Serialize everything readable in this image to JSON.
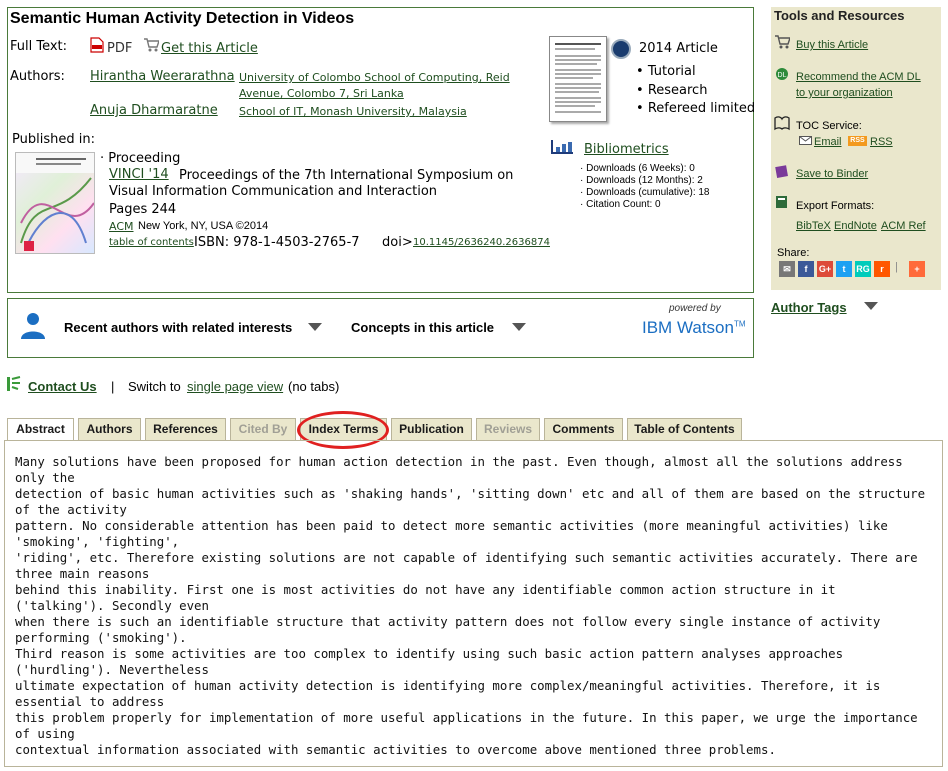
{
  "article": {
    "title": "Semantic Human Activity Detection in Videos",
    "full_text_label": "Full Text:",
    "pdf_label": "PDF",
    "get_article_label": "Get this Article",
    "authors_label": "Authors:",
    "authors": [
      {
        "name": "Hirantha Weerarathna",
        "aff_line1": "University of Colombo School of Computing, Reid",
        "aff_line2": "Avenue, Colombo 7, Sri Lanka"
      },
      {
        "name": "Anuja Dharmaratne",
        "aff_line1": "School of IT, Monash University, Malaysia",
        "aff_line2": ""
      }
    ],
    "published_in_label": "Published in:",
    "proceeding_label": "· Proceeding",
    "venue_link": "VINCI '14",
    "venue_title_1": "Proceedings of the 7th International Symposium on",
    "venue_title_2": "Visual Information Communication and Interaction",
    "pages": "Pages 244",
    "publisher_link": "ACM",
    "publisher_loc": "New York, NY, USA ©2014",
    "toc_link": "table of contents",
    "isbn": "ISBN: 978-1-4503-2765-7",
    "doi_label": "doi>",
    "doi_link": "10.1145/2636240.2636874",
    "year_label": "2014 Article",
    "article_types": [
      "Tutorial",
      "Research",
      "Refereed limited"
    ],
    "bibliometrics_label": "Bibliometrics",
    "bibliometrics": [
      "· Downloads (6 Weeks): 0",
      "· Downloads (12 Months): 2",
      "· Downloads (cumulative): 18",
      "· Citation Count: 0"
    ]
  },
  "sidebar": {
    "header": "Tools and Resources",
    "buy": "Buy this Article",
    "recommend_1": "Recommend the ACM DL",
    "recommend_2": "to your organization",
    "toc_service": "TOC Service:",
    "email": "Email",
    "rss": "RSS",
    "rss_badge": "RSS",
    "binder": "Save to Binder",
    "export_formats": "Export Formats:",
    "bibtex": "BibTeX",
    "endnote": "EndNote",
    "acmref": "ACM Ref",
    "share": "Share:",
    "author_tags": "Author Tags"
  },
  "watson": {
    "recent_authors": "Recent authors with related interests",
    "concepts": "Concepts in this article",
    "powered_by": "powered by",
    "brand": "IBM Watson",
    "tm": "TM"
  },
  "contact": {
    "contact_us": "Contact Us",
    "separator": "|",
    "switch_to": "Switch to",
    "single_page": "single page view",
    "no_tabs": "(no tabs)"
  },
  "tabs": [
    {
      "label": "Abstract"
    },
    {
      "label": "Authors"
    },
    {
      "label": "References"
    },
    {
      "label": "Cited By"
    },
    {
      "label": "Index Terms"
    },
    {
      "label": "Publication"
    },
    {
      "label": "Reviews"
    },
    {
      "label": "Comments"
    },
    {
      "label": "Table of Contents"
    }
  ],
  "abstract_lines": [
    "Many solutions have been proposed for human action detection in the past. Even though, almost all the solutions address only the",
    "detection of basic human activities such as 'shaking hands', 'sitting down' etc and all of them are based on the structure of the activity",
    "pattern. No considerable attention has been paid to detect more semantic activities (more meaningful activities) like 'smoking', 'fighting',",
    "'riding', etc. Therefore existing solutions are not capable of identifying such semantic activities accurately. There are three main reasons",
    "behind this inability. First one is most activities do not have any identifiable common action structure in it ('talking'). Secondly even",
    "when there is such an identifiable structure that activity pattern does not follow every single instance of activity performing ('smoking').",
    "Third reason is some activities are too complex to identify using such basic action pattern analyses approaches ('hurdling'). Nevertheless",
    "ultimate expectation of human activity detection is identifying more complex/meaningful activities. Therefore, it is essential to address",
    "this problem properly for implementation of more useful applications in the future. In this paper, we urge the importance of using",
    "contextual information associated with semantic activities to overcome above mentioned three problems."
  ],
  "colors": {
    "border_green": "#4a7a3a",
    "link_green": "#1f4e1f",
    "sidebar_bg": "#eae7cc",
    "highlight_red": "#e02020",
    "watson_blue": "#1b6ec2"
  }
}
